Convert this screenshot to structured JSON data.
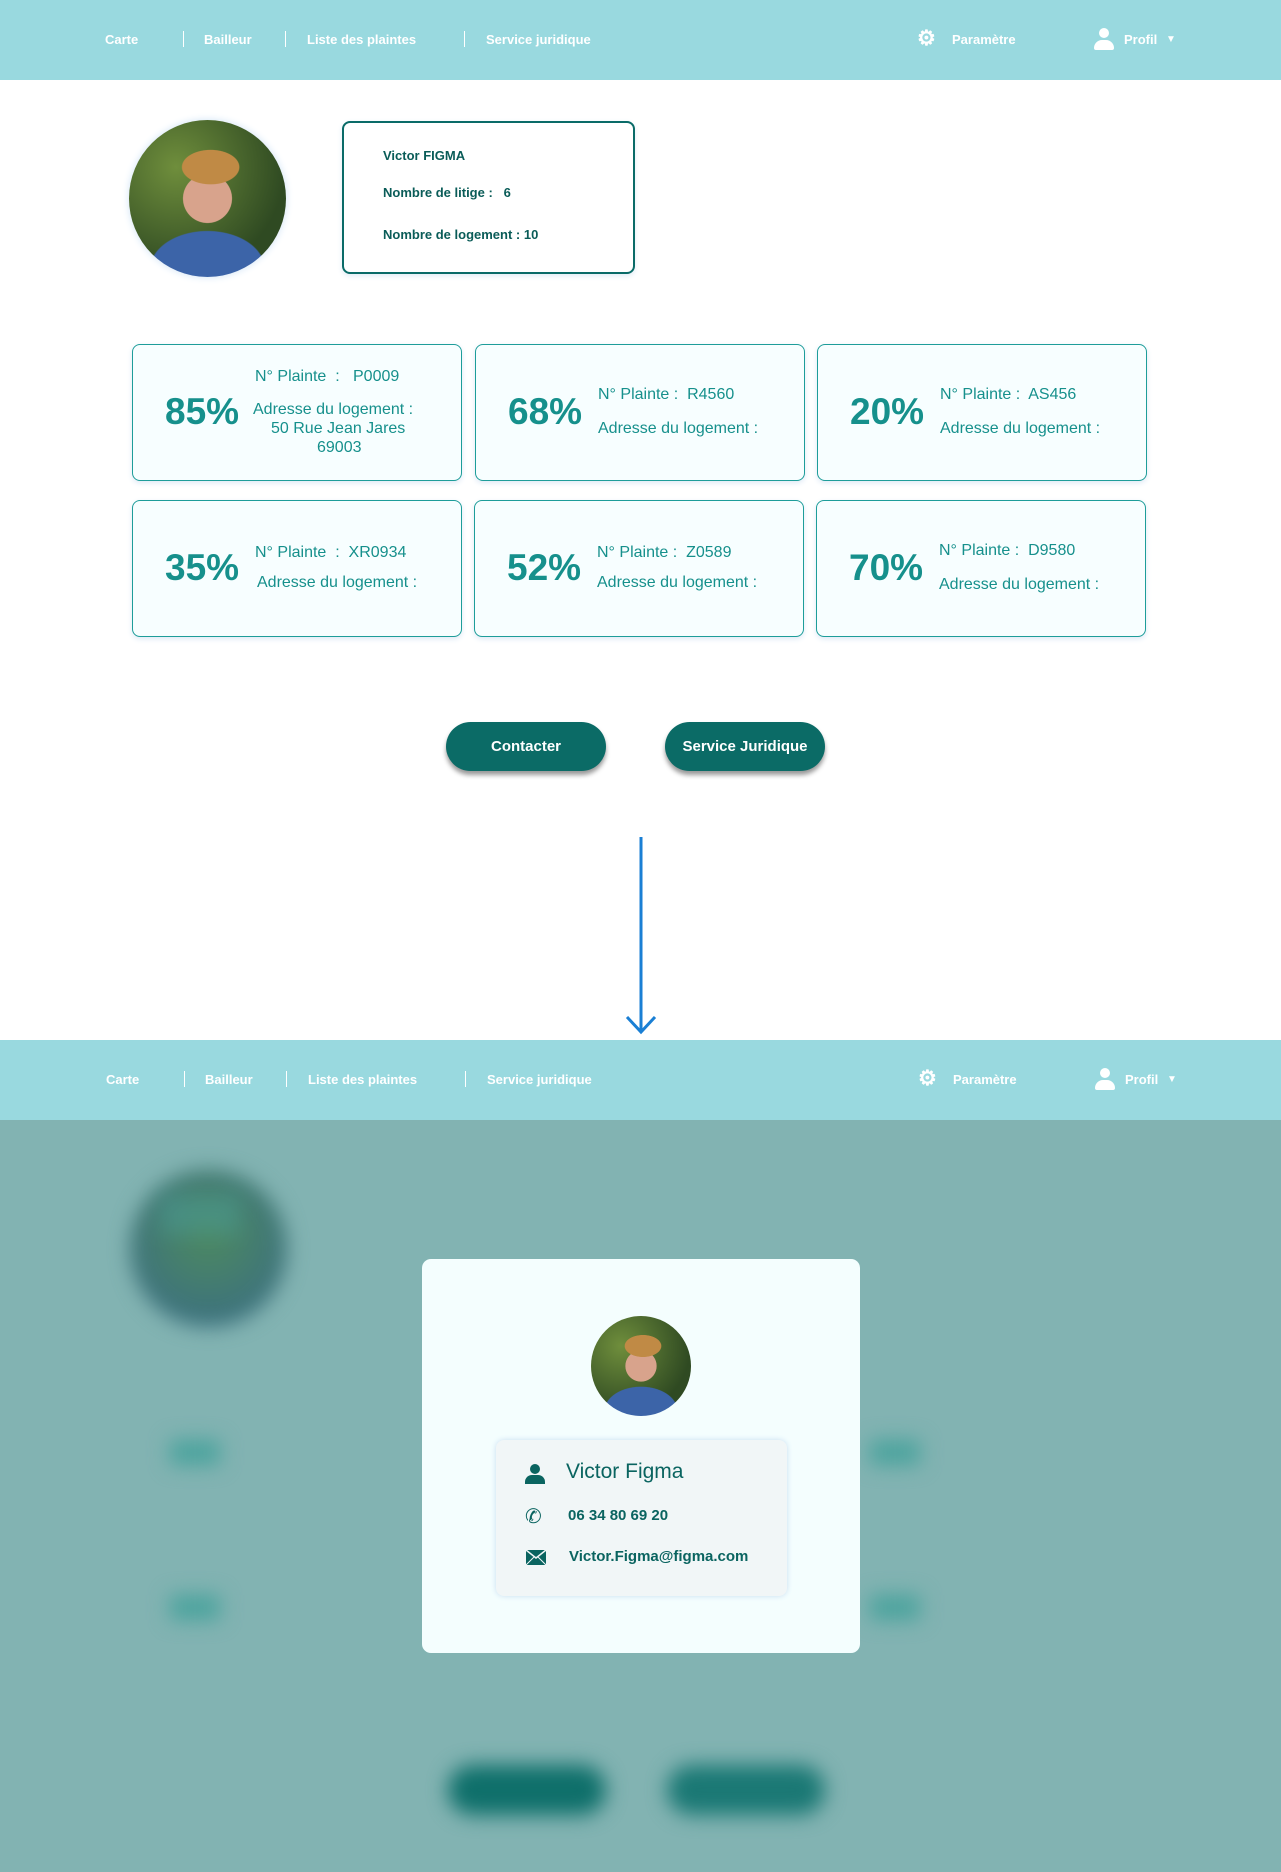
{
  "nav": {
    "items": [
      "Carte",
      "Bailleur",
      "Liste des plaintes",
      "Service juridique"
    ],
    "settings": "Paramètre",
    "profile": "Profil",
    "icons": [
      "gear-icon",
      "user-icon",
      "caret-down-icon"
    ]
  },
  "profile": {
    "name": "Victor FIGMA",
    "litiges": "Nombre de litige :   6",
    "logements": "Nombre de logement : 10"
  },
  "complaints": [
    {
      "pct": "85%",
      "id": "N° Plainte  :   P0009",
      "addr_label": "Adresse du logement :",
      "addr1": "50 Rue Jean Jares",
      "addr2": "69003"
    },
    {
      "pct": "68%",
      "id": "N° Plainte :  R4560",
      "addr_label": "Adresse du logement :"
    },
    {
      "pct": "20%",
      "id": "N° Plainte :  AS456",
      "addr_label": "Adresse du logement :"
    },
    {
      "pct": "35%",
      "id": "N° Plainte  :  XR0934",
      "addr_label": "Adresse du logement :"
    },
    {
      "pct": "52%",
      "id": "N° Plainte :  Z0589",
      "addr_label": "Adresse du logement :"
    },
    {
      "pct": "70%",
      "id": "N° Plainte :  D9580",
      "addr_label": "Adresse du logement :"
    }
  ],
  "buttons": {
    "contact": "Contacter",
    "legal": "Service Juridique"
  },
  "modal": {
    "name": "Victor Figma",
    "phone": "06 34 80 69 20",
    "email": "Victor.Figma@figma.com"
  },
  "colors": {
    "nav": "#99d9df",
    "primary": "#0b6b66",
    "accent": "#16908c",
    "arrow": "#1a7fd4",
    "overlay": "#82b3b2"
  }
}
